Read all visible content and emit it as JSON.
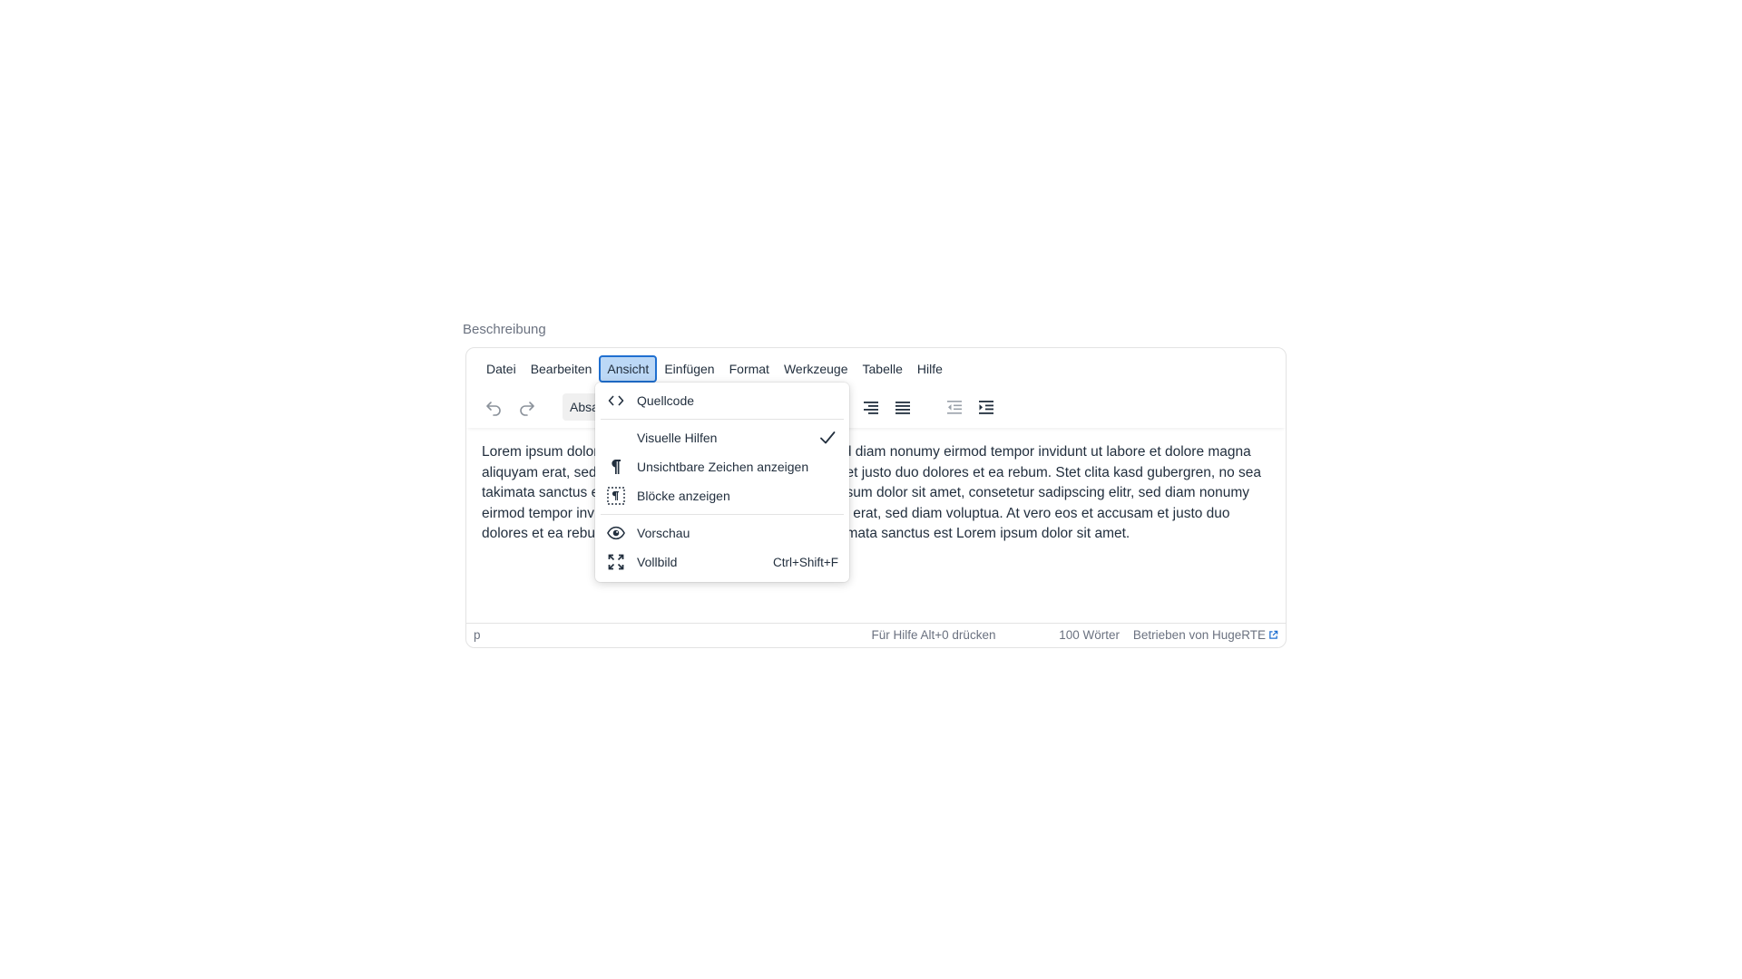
{
  "field_label": "Beschreibung",
  "menubar": {
    "items": [
      "Datei",
      "Bearbeiten",
      "Ansicht",
      "Einfügen",
      "Format",
      "Werkzeuge",
      "Tabelle",
      "Hilfe"
    ],
    "active": "Ansicht"
  },
  "toolbar": {
    "block_format_visible": "Absa"
  },
  "content": {
    "paragraph": "Lorem ipsum dolor sit amet, consetetur sadipscing elitr, sed diam nonumy eirmod tempor invidunt ut labore et dolore magna aliquyam erat, sed diam voluptua. At vero eos et accusam et justo duo dolores et ea rebum. Stet clita kasd gubergren, no sea takimata sanctus est Lorem ipsum dolor sit amet. Lorem ipsum dolor sit amet, consetetur sadipscing elitr, sed diam nonumy eirmod tempor invidunt ut labore et dolore magna aliquyam erat, sed diam voluptua. At vero eos et accusam et justo duo dolores et ea rebum. Stet clita kasd gubergren, no sea takimata sanctus est Lorem ipsum dolor sit amet."
  },
  "statusbar": {
    "path": "p",
    "help": "Für Hilfe Alt+0 drücken",
    "words": "100 Wörter",
    "brand": "Betrieben von HugeRTE"
  },
  "dropdown": {
    "source_code": "Quellcode",
    "visual_aids": "Visuelle Hilfen",
    "visual_aids_checked": true,
    "show_invisible": "Unsichtbare Zeichen anzeigen",
    "show_blocks": "Blöcke anzeigen",
    "preview": "Vorschau",
    "fullscreen": "Vollbild",
    "fullscreen_shortcut": "Ctrl+Shift+F"
  },
  "colors": {
    "accent": "#1f6fd0",
    "active_bg": "#bcd8f6",
    "text": "#222f3e",
    "muted": "#6b7280"
  }
}
